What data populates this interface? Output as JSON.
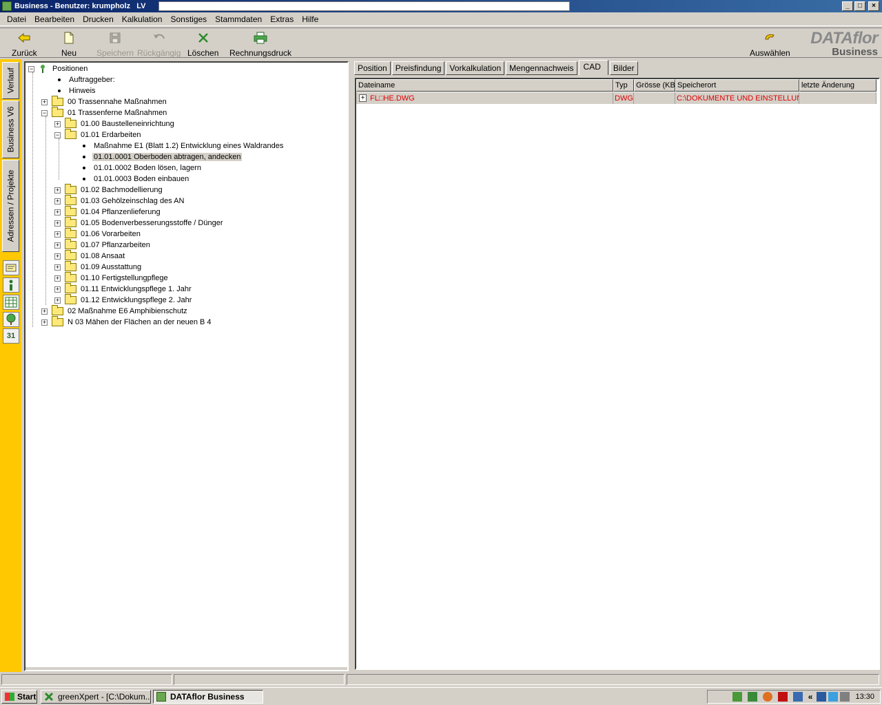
{
  "window": {
    "title": "Business - Benutzer: krumpholz   LV",
    "buttons": {
      "minimize": "_",
      "maximize": "□",
      "close": "×"
    }
  },
  "menu": [
    "Datei",
    "Bearbeiten",
    "Drucken",
    "Kalkulation",
    "Sonstiges",
    "Stammdaten",
    "Extras",
    "Hilfe"
  ],
  "toolbar": {
    "back": "Zurück",
    "new": "Neu",
    "save": "Speichern",
    "undo": "Rückgängig",
    "delete": "Löschen",
    "invoice_print": "Rechnungsdruck",
    "select": "Auswählen"
  },
  "logo": {
    "line1": "DATAflor",
    "line2": "Business"
  },
  "side_tabs": [
    "Verlauf",
    "Business V6",
    "Adressen / Projekte"
  ],
  "side_icons": {
    "calendar_day": "31"
  },
  "tree": {
    "root": "Positionen",
    "items": [
      "Auftraggeber:",
      "Hinweis",
      "00 Trassennahe Maßnahmen",
      "01 Trassenferne Maßnahmen",
      "01.00 Baustelleneinrichtung",
      "01.01 Erdarbeiten",
      "Maßnahme E1 (Blatt 1.2) Entwicklung eines Waldrandes",
      "01.01.0001 Oberboden abtragen, andecken",
      "01.01.0002 Boden lösen, lagern",
      "01.01.0003 Boden einbauen",
      "01.02 Bachmodellierung",
      "01.03 Gehölzeinschlag des AN",
      "01.04 Pflanzenlieferung",
      "01.05 Bodenverbesserungsstoffe / Dünger",
      "01.06 Vorarbeiten",
      "01.07 Pflanzarbeiten",
      "01.08 Ansaat",
      "01.09 Ausstattung",
      "01.10 Fertigstellungpflege",
      "01.11 Entwicklungspflege 1. Jahr",
      "01.12 Entwicklungspflege 2. Jahr",
      "02 Maßnahme E6 Amphibienschutz",
      "N 03 Mähen der Flächen an der neuen B 4"
    ]
  },
  "tabs": [
    "Position",
    "Preisfindung",
    "Vorkalkulation",
    "Mengennachweis",
    "CAD",
    "Bilder"
  ],
  "active_tab": "CAD",
  "grid": {
    "columns": [
      "Dateiname",
      "Typ",
      "Grösse (KB)",
      "Speicherort",
      "letzte Änderung"
    ],
    "rows": [
      {
        "expand": "+",
        "name": "FL□HE.DWG",
        "type": "DWG",
        "size": "",
        "location": "C:\\DOKUMENTE UND EINSTELLUN...",
        "changed": ""
      }
    ]
  },
  "taskbar": {
    "start": "Start",
    "tasks": [
      "greenXpert - [C:\\Dokum...",
      "DATAflor Business"
    ],
    "tray_chevron": "»",
    "tray_chevron2": "«",
    "clock": "13:30"
  },
  "colors": {
    "accent_yellow": "#ffc800",
    "title_blue": "#0a246a",
    "red_text": "#e00000"
  }
}
